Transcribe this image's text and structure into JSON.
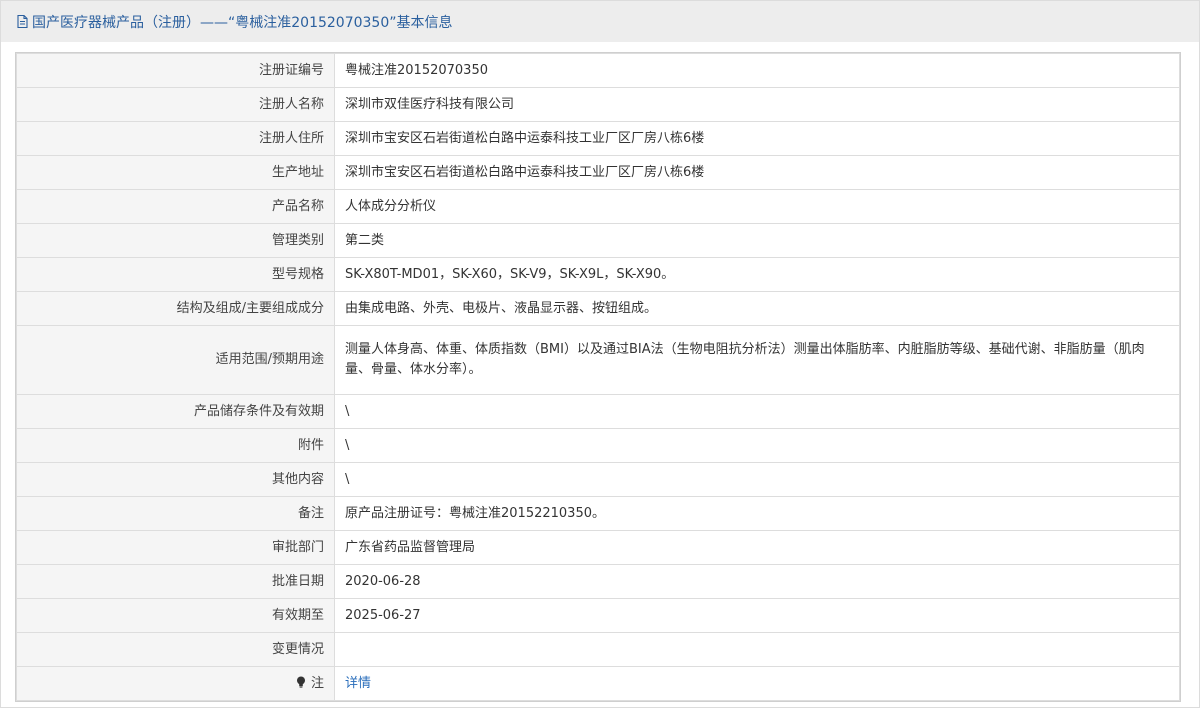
{
  "header": {
    "title": "国产医疗器械产品（注册）——“粤械注准20152070350”基本信息",
    "icon": "document-icon"
  },
  "rows": [
    {
      "label": "注册证编号",
      "value": "粤械注准20152070350"
    },
    {
      "label": "注册人名称",
      "value": "深圳市双佳医疗科技有限公司"
    },
    {
      "label": "注册人住所",
      "value": "深圳市宝安区石岩街道松白路中运泰科技工业厂区厂房八栋6楼"
    },
    {
      "label": "生产地址",
      "value": "深圳市宝安区石岩街道松白路中运泰科技工业厂区厂房八栋6楼"
    },
    {
      "label": "产品名称",
      "value": "人体成分分析仪"
    },
    {
      "label": "管理类别",
      "value": "第二类"
    },
    {
      "label": "型号规格",
      "value": "SK-X80T-MD01，SK-X60，SK-V9，SK-X9L，SK-X90。"
    },
    {
      "label": "结构及组成/主要组成成分",
      "value": "由集成电路、外壳、电极片、液晶显示器、按钮组成。"
    },
    {
      "label": "适用范围/预期用途",
      "value": "测量人体身高、体重、体质指数（BMI）以及通过BIA法（生物电阻抗分析法）测量出体脂肪率、内脏脂肪等级、基础代谢、非脂肪量（肌肉量、骨量、体水分率）。"
    },
    {
      "label": "产品储存条件及有效期",
      "value": "\\"
    },
    {
      "label": "附件",
      "value": "\\"
    },
    {
      "label": "其他内容",
      "value": "\\"
    },
    {
      "label": "备注",
      "value": "原产品注册证号：粤械注准20152210350。"
    },
    {
      "label": "审批部门",
      "value": "广东省药品监督管理局"
    },
    {
      "label": "批准日期",
      "value": "2020-06-28"
    },
    {
      "label": "有效期至",
      "value": "2025-06-27"
    },
    {
      "label": "变更情况",
      "value": ""
    }
  ],
  "note_row": {
    "icon": "bulb-icon",
    "label": "注",
    "link_text": "详情"
  },
  "colors": {
    "header_text": "#2a5f9e",
    "link": "#2a6ebb",
    "label_bg": "#f5f5f5"
  }
}
